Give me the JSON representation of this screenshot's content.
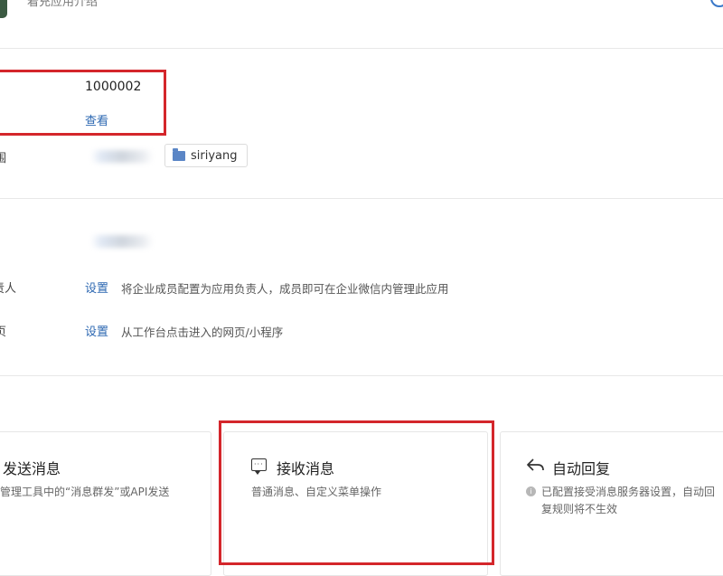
{
  "header": {
    "app_description": "着充应用介绍",
    "right_text": "..."
  },
  "details": {
    "agent_id": "1000002",
    "secret_link": "查看",
    "row_partial_label_1": "围",
    "folder_name": "siriyang"
  },
  "settings": {
    "row_admin_label": "责人",
    "row_admin_link": "设置",
    "row_admin_hint": "将企业成员配置为应用负责人，成员即可在企业微信内管理此应用",
    "row_homepage_label": "页",
    "row_homepage_link": "设置",
    "row_homepage_hint": "从工作台点击进入的网页/小程序"
  },
  "cards": [
    {
      "title": "发送消息",
      "desc": "管理工具中的“消息群发”或API发送",
      "icon": "send-icon"
    },
    {
      "title": "接收消息",
      "desc": "普通消息、自定义菜单操作",
      "icon": "chat-bubble-icon"
    },
    {
      "title": "自动回复",
      "desc": "已配置接受消息服务器设置，自动回复规则将不生效",
      "desc_line1": "已配置接受消息服务器设置，自动回",
      "desc_line2": "复规则将不生效",
      "icon": "reply-arrow-icon"
    }
  ],
  "colors": {
    "link": "#2d68b2",
    "highlight": "#d4262b",
    "folder": "#5b86c6"
  }
}
